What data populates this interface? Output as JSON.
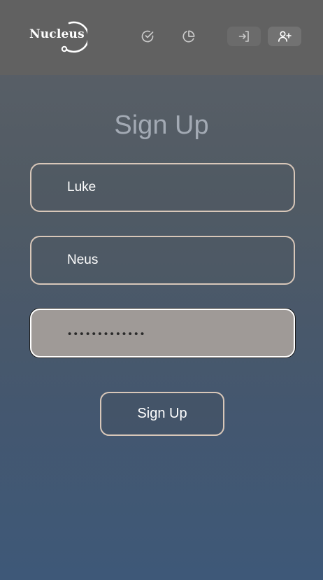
{
  "header": {
    "logo_text": "Nucleus",
    "nav": [
      {
        "icon": "check-circle-icon"
      },
      {
        "icon": "pie-chart-icon"
      },
      {
        "icon": "login-icon"
      },
      {
        "icon": "user-plus-icon"
      }
    ]
  },
  "form": {
    "title": "Sign Up",
    "first_name_value": "Luke",
    "last_name_value": "Neus",
    "password_value": "•••••••••••••",
    "submit_label": "Sign Up"
  },
  "colors": {
    "header_bg": "#616161",
    "field_border": "#d8c7b9",
    "password_bg": "#9f9a97",
    "title_text": "#a3aab4"
  }
}
